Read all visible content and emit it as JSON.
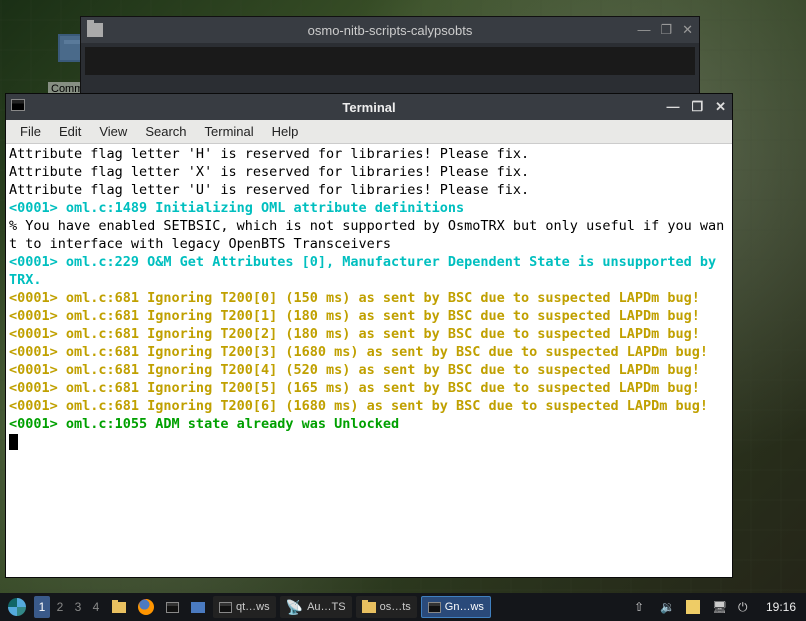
{
  "desktop": {
    "icon_label": "Comm"
  },
  "back_window": {
    "title": "osmo-nitb-scripts-calypsobts",
    "minimize": "—",
    "maximize": "❐",
    "close": "✕"
  },
  "terminal": {
    "title": "Terminal",
    "minimize": "—",
    "maximize": "❐",
    "close": "✕",
    "menu": [
      "File",
      "Edit",
      "View",
      "Search",
      "Terminal",
      "Help"
    ],
    "lines": [
      {
        "cls": "",
        "text": "Attribute flag letter 'H' is reserved for libraries! Please fix."
      },
      {
        "cls": "",
        "text": "Attribute flag letter 'X' is reserved for libraries! Please fix."
      },
      {
        "cls": "",
        "text": "Attribute flag letter 'U' is reserved for libraries! Please fix."
      },
      {
        "cls": "c-cyan",
        "text": "<0001> oml.c:1489 Initializing OML attribute definitions"
      },
      {
        "cls": "",
        "text": "% You have enabled SETBSIC, which is not supported by OsmoTRX but only useful if you want to interface with legacy OpenBTS Transceivers"
      },
      {
        "cls": "c-cyan",
        "text": "<0001> oml.c:229 O&M Get Attributes [0], Manufacturer Dependent State is unsupported by TRX."
      },
      {
        "cls": "c-yellow",
        "text": "<0001> oml.c:681 Ignoring T200[0] (150 ms) as sent by BSC due to suspected LAPDm bug!"
      },
      {
        "cls": "c-yellow",
        "text": "<0001> oml.c:681 Ignoring T200[1] (180 ms) as sent by BSC due to suspected LAPDm bug!"
      },
      {
        "cls": "c-yellow",
        "text": "<0001> oml.c:681 Ignoring T200[2] (180 ms) as sent by BSC due to suspected LAPDm bug!"
      },
      {
        "cls": "c-yellow",
        "text": "<0001> oml.c:681 Ignoring T200[3] (1680 ms) as sent by BSC due to suspected LAPDm bug!"
      },
      {
        "cls": "c-yellow",
        "text": "<0001> oml.c:681 Ignoring T200[4] (520 ms) as sent by BSC due to suspected LAPDm bug!"
      },
      {
        "cls": "c-yellow",
        "text": "<0001> oml.c:681 Ignoring T200[5] (165 ms) as sent by BSC due to suspected LAPDm bug!"
      },
      {
        "cls": "c-yellow",
        "text": "<0001> oml.c:681 Ignoring T200[6] (1680 ms) as sent by BSC due to suspected LAPDm bug!"
      },
      {
        "cls": "c-green",
        "text": "<0001> oml.c:1055 ADM state already was Unlocked"
      }
    ]
  },
  "taskbar": {
    "workspaces": [
      "1",
      "2",
      "3",
      "4"
    ],
    "active_ws": 0,
    "tasks": [
      {
        "label": "qt…ws",
        "icon": "term",
        "active": false
      },
      {
        "label": "Au…TS",
        "icon": "ant",
        "active": false
      },
      {
        "label": "os…ts",
        "icon": "folder",
        "active": false
      },
      {
        "label": "Gn…ws",
        "icon": "term",
        "active": true
      }
    ],
    "clock": "19:16"
  }
}
